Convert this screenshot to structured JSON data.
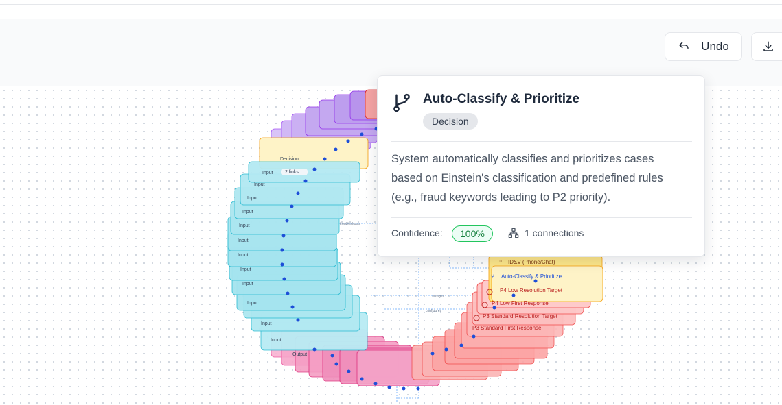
{
  "toolbar": {
    "undo_label": "Undo",
    "undo_icon": "undo-icon",
    "download_icon": "download-icon"
  },
  "graph": {
    "left_nodes": [
      "Input",
      "Input",
      "Input",
      "Input",
      "Input",
      "Input",
      "Input",
      "Input",
      "Input",
      "Input",
      "Input"
    ],
    "left_node_badge": "2 links",
    "decision_node_label": "Decision",
    "bottom_label": "Output",
    "right_nodes": [
      {
        "label": "ID&V (Phone/Chat)",
        "color": "#f59e0b"
      },
      {
        "label": "Auto-Classify & Prioritize",
        "color": "#2563eb"
      },
      {
        "label": "P4 Low Resolution Target",
        "color": "#dc2626"
      },
      {
        "label": "P4 Low First Response",
        "color": "#dc2626"
      },
      {
        "label": "P3 Standard Resolution Target",
        "color": "#dc2626"
      },
      {
        "label": "P3 Standard First Response",
        "color": "#dc2626"
      }
    ],
    "edge_labels": [
      "troubleshoots",
      "assigns",
      "configures"
    ]
  },
  "tooltip": {
    "title": "Auto-Classify & Prioritize",
    "icon": "git-branch-icon",
    "type_badge": "Decision",
    "description": "System automatically classifies and prioritizes cases based on Einstein's classification and predefined rules (e.g., fraud keywords leading to P2 priority).",
    "confidence_label": "Confidence:",
    "confidence_value": "100%",
    "connections_label": "1 connections",
    "connections_icon": "network-icon"
  },
  "colors": {
    "input_node": "#a5e4ef",
    "input_border": "#22b8cf",
    "purple_node": "#c4a8f0",
    "pink_node": "#f4a3c8",
    "red_node": "#fca5a5",
    "amber_node": "#fde68a",
    "accent_green": "#22c55e"
  }
}
